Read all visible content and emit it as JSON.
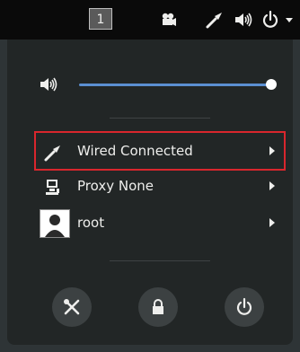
{
  "topbar": {
    "workspace_label": "1",
    "icons": [
      "camera-icon",
      "wired-network-icon",
      "speaker-icon",
      "power-icon",
      "chevron-down-icon"
    ]
  },
  "volume": {
    "icon": "speaker-icon",
    "level": 1.0
  },
  "menu_items": [
    {
      "label": "Wired Connected",
      "icon": "wired-network-icon"
    },
    {
      "label": "Proxy None",
      "icon": "proxy-icon"
    },
    {
      "label": "root",
      "icon": "avatar"
    }
  ],
  "actions": [
    "settings-icon",
    "lock-icon",
    "power-icon"
  ],
  "colors": {
    "accent": "#5b8fd1",
    "highlight": "#d9262d"
  }
}
